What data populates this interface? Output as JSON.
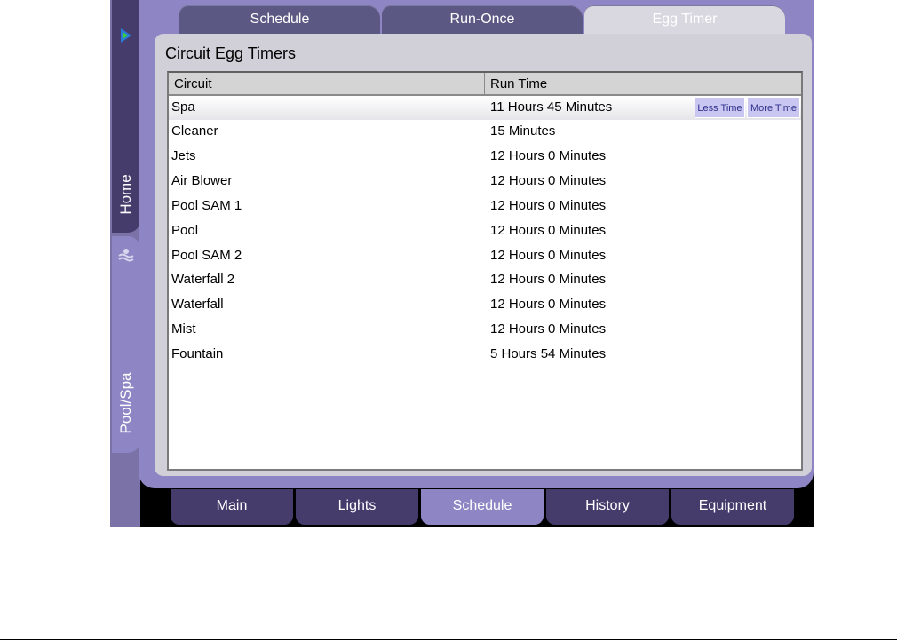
{
  "side_tabs": [
    {
      "label": "Home",
      "icon": "home-arrow-icon",
      "active": false
    },
    {
      "label": "Pool/Spa",
      "icon": "pool-waves-icon",
      "active": true
    }
  ],
  "top_tabs": [
    {
      "label": "Schedule",
      "active": false
    },
    {
      "label": "Run-Once",
      "active": false
    },
    {
      "label": "Egg Timer",
      "active": true
    }
  ],
  "panel": {
    "title": "Circuit Egg Timers",
    "columns": [
      "Circuit",
      "Run Time"
    ],
    "rows": [
      {
        "circuit": "Spa",
        "run_time": "11 Hours 45 Minutes",
        "selected": true
      },
      {
        "circuit": "Cleaner",
        "run_time": "15 Minutes"
      },
      {
        "circuit": "Jets",
        "run_time": "12 Hours 0 Minutes"
      },
      {
        "circuit": "Air Blower",
        "run_time": "12 Hours 0 Minutes"
      },
      {
        "circuit": "Pool SAM 1",
        "run_time": "12 Hours 0 Minutes"
      },
      {
        "circuit": "Pool",
        "run_time": "12 Hours 0 Minutes"
      },
      {
        "circuit": "Pool SAM 2",
        "run_time": "12 Hours 0 Minutes"
      },
      {
        "circuit": "Waterfall 2",
        "run_time": "12 Hours 0 Minutes"
      },
      {
        "circuit": "Waterfall",
        "run_time": "12 Hours 0 Minutes"
      },
      {
        "circuit": "Mist",
        "run_time": "12 Hours 0 Minutes"
      },
      {
        "circuit": "Fountain",
        "run_time": "5 Hours 54 Minutes"
      }
    ],
    "row_buttons": {
      "less": "Less Time",
      "more": "More Time"
    }
  },
  "bottom_tabs": [
    {
      "label": "Main",
      "active": false
    },
    {
      "label": "Lights",
      "active": false
    },
    {
      "label": "Schedule",
      "active": true
    },
    {
      "label": "History",
      "active": false
    },
    {
      "label": "Equipment",
      "active": false
    }
  ],
  "colors": {
    "plate": "#8e86c4",
    "tab_dark": "#453c6c",
    "tab_active_top": "#d9d8e0",
    "button": "#c9c6f2"
  }
}
